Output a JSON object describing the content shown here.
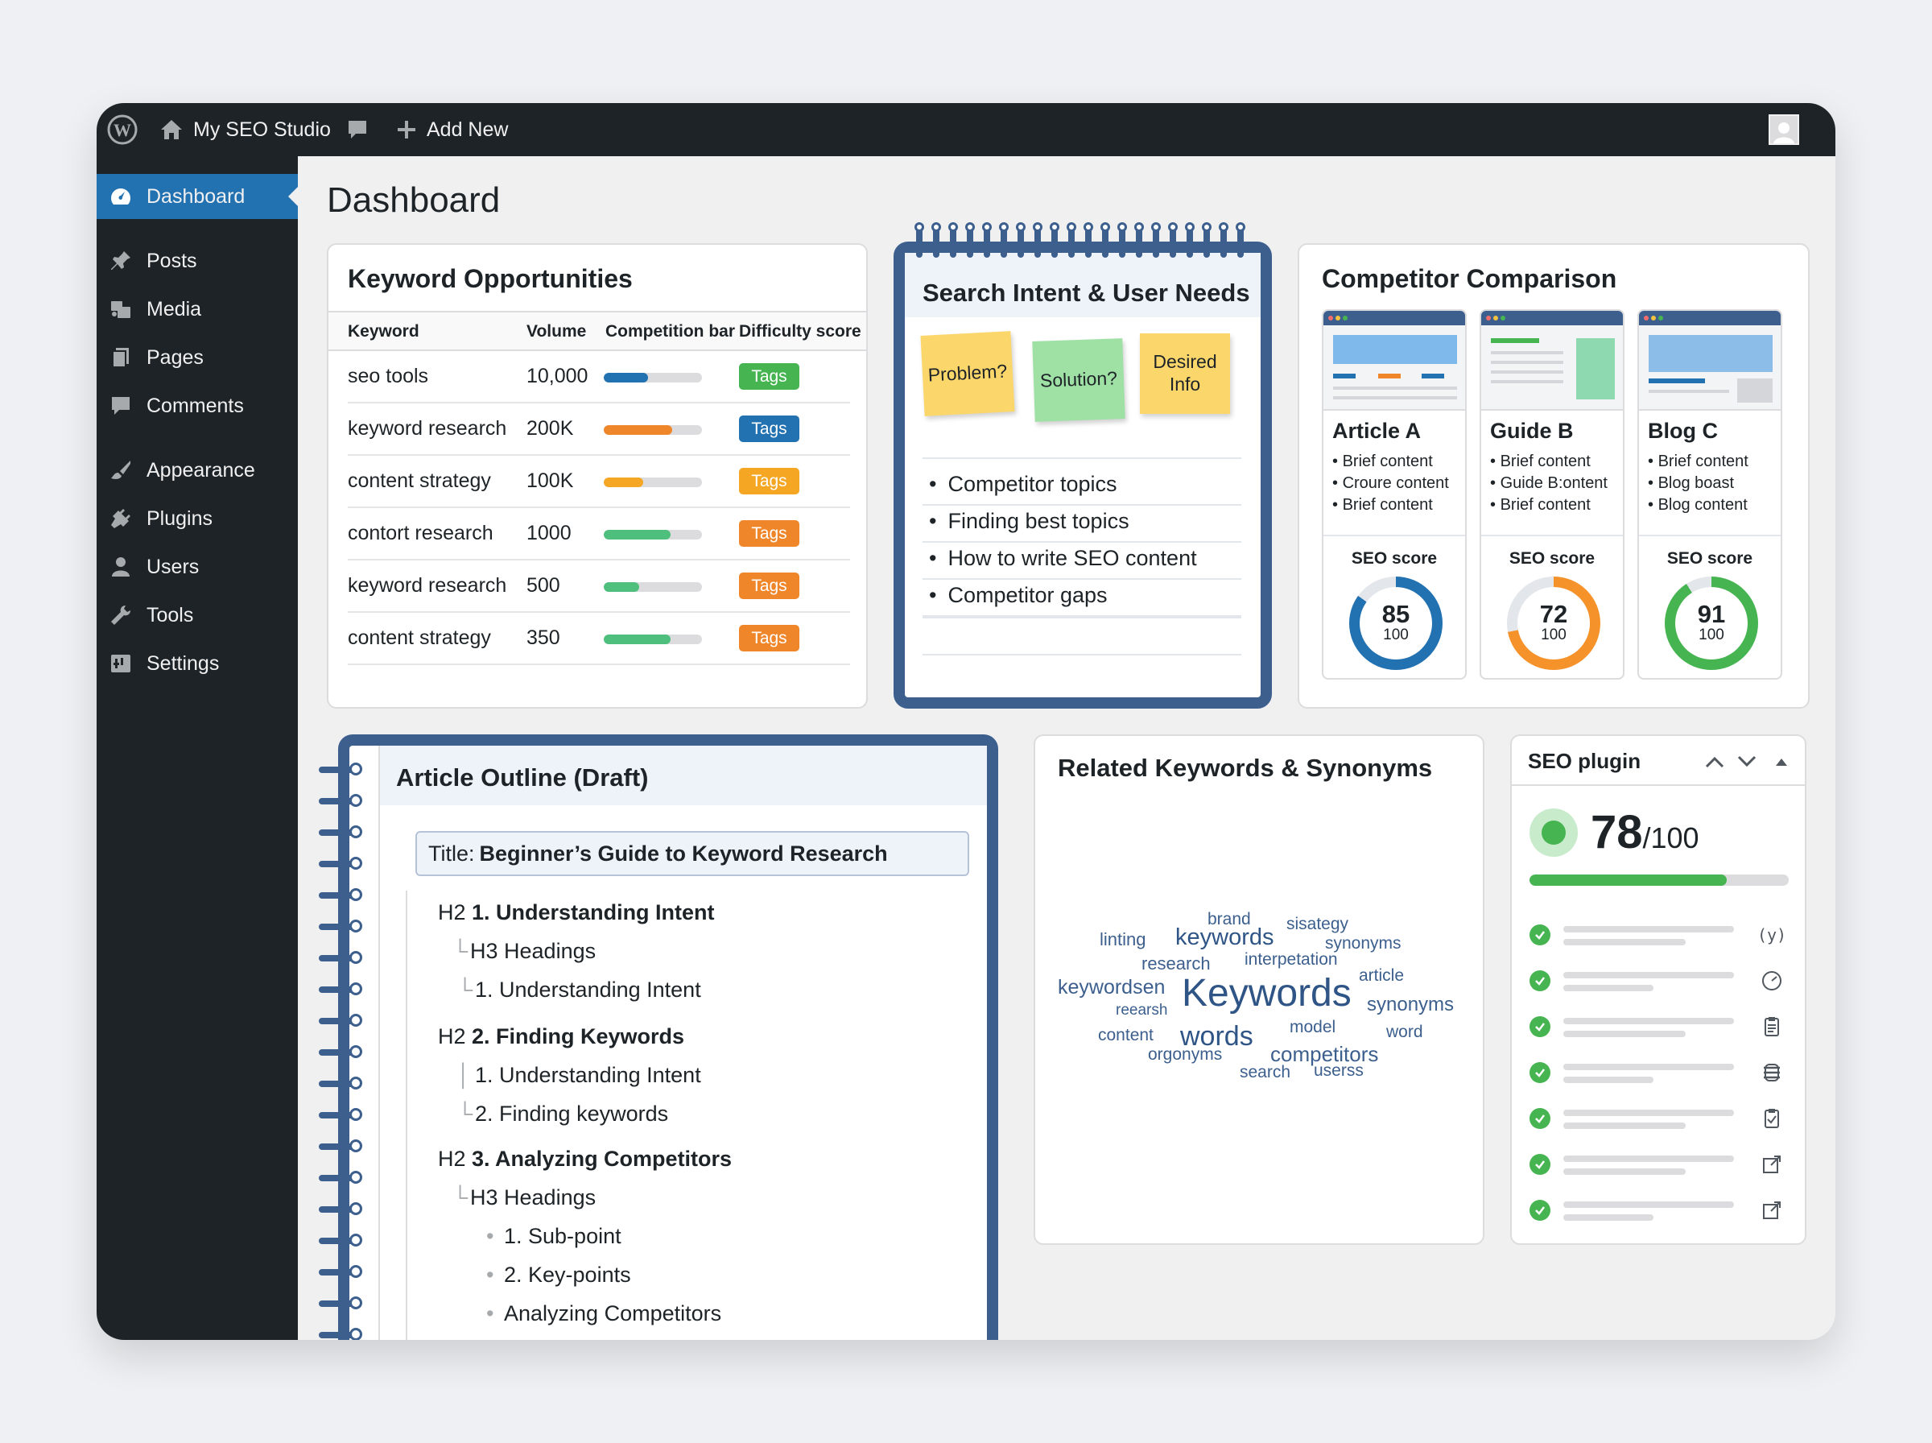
{
  "adminbar": {
    "site_name": "My SEO Studio",
    "add_new": "Add New"
  },
  "sidebar": {
    "items": [
      {
        "label": "Dashboard",
        "icon": "dashboard-icon",
        "active": true
      },
      {
        "label": "Posts",
        "icon": "pin-icon"
      },
      {
        "label": "Media",
        "icon": "media-icon"
      },
      {
        "label": "Pages",
        "icon": "pages-icon"
      },
      {
        "label": "Comments",
        "icon": "comment-icon"
      },
      {
        "label": "Appearance",
        "icon": "brush-icon"
      },
      {
        "label": "Plugins",
        "icon": "plug-icon"
      },
      {
        "label": "Users",
        "icon": "user-icon"
      },
      {
        "label": "Tools",
        "icon": "wrench-icon"
      },
      {
        "label": "Settings",
        "icon": "settings-icon"
      }
    ]
  },
  "page_title": "Dashboard",
  "keywords": {
    "title": "Keyword Opportunities",
    "headers": [
      "Keyword",
      "Volume",
      "Competition bar",
      "Difficulty score"
    ],
    "rows": [
      {
        "keyword": "seo tools",
        "volume": "10,000",
        "competition": 0.45,
        "bar_color": "#2271b1",
        "tag": "Tags",
        "tag_color": "#46b450"
      },
      {
        "keyword": "keyword research",
        "volume": "200K",
        "competition": 0.7,
        "bar_color": "#f0862a",
        "tag": "Tags",
        "tag_color": "#2271b1"
      },
      {
        "keyword": "content strategy",
        "volume": "100K",
        "competition": 0.4,
        "bar_color": "#f5a623",
        "tag": "Tags",
        "tag_color": "#f5a623"
      },
      {
        "keyword": "contort research",
        "volume": "1000",
        "competition": 0.68,
        "bar_color": "#4fbf7e",
        "tag": "Tags",
        "tag_color": "#f0862a"
      },
      {
        "keyword": "keyword research",
        "volume": "500",
        "competition": 0.36,
        "bar_color": "#4fbf7e",
        "tag": "Tags",
        "tag_color": "#f0862a"
      },
      {
        "keyword": "content strategy",
        "volume": "350",
        "competition": 0.68,
        "bar_color": "#4fbf7e",
        "tag": "Tags",
        "tag_color": "#f0862a"
      }
    ]
  },
  "intent": {
    "title": "Search Intent & User Needs",
    "stickies": [
      {
        "text": "Problem?",
        "color": "#fbd66b"
      },
      {
        "text": "Solution?",
        "color": "#9fe1a5"
      },
      {
        "text": "Desired Info",
        "color": "#fbd66b"
      }
    ],
    "bullets": [
      "Competitor topics",
      "Finding best topics",
      "How to write SEO content",
      "Competitor gaps"
    ]
  },
  "competitors": {
    "title": "Competitor Comparison",
    "items": [
      {
        "name": "Article A",
        "lines": [
          "Brief content",
          "Croure content",
          "Brief content"
        ],
        "score_label": "SEO score",
        "score": 85,
        "max": "100",
        "color": "#2271b1"
      },
      {
        "name": "Guide B",
        "lines": [
          "Brief content",
          "Guide B:ontent",
          "Brief content"
        ],
        "score_label": "SEO score",
        "score": 72,
        "max": "100",
        "color": "#f5922a"
      },
      {
        "name": "Blog C",
        "lines": [
          "Brief content",
          "Blog boast",
          "Blog content"
        ],
        "score_label": "SEO score",
        "score": 91,
        "max": "100",
        "color": "#46b450"
      }
    ]
  },
  "outline": {
    "title": "Article Outline (Draft)",
    "doc_title_label": "Title:",
    "doc_title": "Beginner’s Guide to Keyword Research",
    "lines": [
      {
        "prefix": "H2",
        "text": "1. Understanding Intent",
        "bold": true
      },
      {
        "prefix": "H3",
        "text": "Headings",
        "bold": false
      },
      {
        "prefix": "",
        "text": "1. Understanding Intent",
        "bold": false
      },
      {
        "prefix": "H2",
        "text": "2. Finding Keywords",
        "bold": true
      },
      {
        "prefix": "",
        "text": "1. Understanding Intent",
        "bold": false
      },
      {
        "prefix": "",
        "text": "2. Finding keywords",
        "bold": false
      },
      {
        "prefix": "H2",
        "text": "3. Analyzing Competitors",
        "bold": true
      },
      {
        "prefix": "H3",
        "text": "Headings",
        "bold": false
      },
      {
        "prefix": "",
        "text": "1. Sub-point",
        "bold": false
      },
      {
        "prefix": "",
        "text": "2. Key-points",
        "bold": false
      },
      {
        "prefix": "",
        "text": "Analyzing Competitors",
        "bold": false
      }
    ]
  },
  "related": {
    "title": "Related Keywords & Synonyms",
    "words": [
      "brand",
      "sisategy",
      "linting",
      "keywords",
      "synonyms",
      "research",
      "interpetation",
      "article",
      "keywordsen",
      "Keywords",
      "synonyms",
      "reearsh",
      "model",
      "content",
      "words",
      "word",
      "competitors",
      "orgonyms",
      "search",
      "userss"
    ]
  },
  "plugin": {
    "title": "SEO plugin",
    "score": "78",
    "max": "/100",
    "progress": 0.76,
    "checks": [
      "code-icon",
      "gauge-icon",
      "clipboard-icon",
      "stack-icon",
      "clipboard-check-icon",
      "external-link-icon",
      "external-link-icon"
    ]
  }
}
